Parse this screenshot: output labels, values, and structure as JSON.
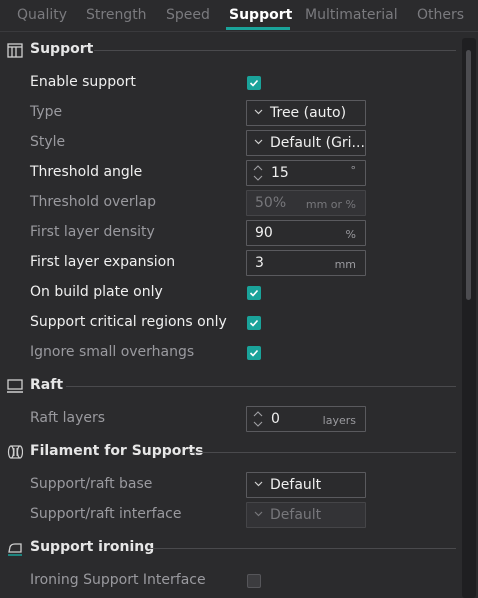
{
  "tabs": {
    "items": [
      "Quality",
      "Strength",
      "Speed",
      "Support",
      "Multimaterial",
      "Others"
    ],
    "active": "Support"
  },
  "sections": {
    "support": {
      "title": "Support",
      "icon": "support-icon"
    },
    "raft": {
      "title": "Raft",
      "icon": "raft-icon"
    },
    "filament": {
      "title": "Filament for Supports",
      "icon": "filament-icon"
    },
    "ironing": {
      "title": "Support ironing",
      "icon": "ironing-icon"
    }
  },
  "settings": {
    "enable_support": {
      "label": "Enable support",
      "checked": true
    },
    "type": {
      "label": "Type",
      "value": "Tree (auto)"
    },
    "style": {
      "label": "Style",
      "value": "Default (Gri..."
    },
    "threshold_angle": {
      "label": "Threshold angle",
      "value": "15",
      "unit": "°"
    },
    "threshold_overlap": {
      "label": "Threshold overlap",
      "value": "50%",
      "unit": "mm or %"
    },
    "first_layer_density": {
      "label": "First layer density",
      "value": "90",
      "unit": "%"
    },
    "first_layer_expansion": {
      "label": "First layer expansion",
      "value": "3",
      "unit": "mm"
    },
    "on_build_plate_only": {
      "label": "On build plate only",
      "checked": true
    },
    "critical_regions_only": {
      "label": "Support critical regions only",
      "checked": true
    },
    "ignore_small_overhangs": {
      "label": "Ignore small overhangs",
      "checked": true
    },
    "raft_layers": {
      "label": "Raft layers",
      "value": "0",
      "unit": "layers"
    },
    "raft_base": {
      "label": "Support/raft base",
      "value": "Default"
    },
    "raft_interface": {
      "label": "Support/raft interface",
      "value": "Default"
    },
    "ironing_interface": {
      "label": "Ironing Support Interface",
      "checked": false
    }
  },
  "colors": {
    "accent": "#1aa39a",
    "background": "#2b2b2d",
    "text": "#e6e6e6",
    "text_dim": "#9a9a9f"
  }
}
